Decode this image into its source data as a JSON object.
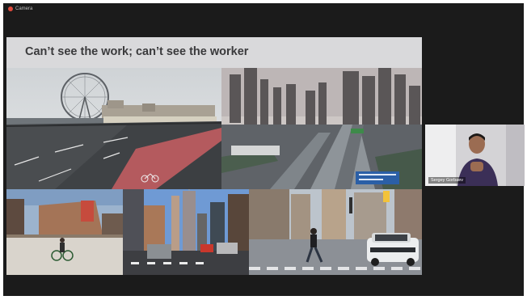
{
  "window": {
    "app_title": "Camera"
  },
  "slide": {
    "title": "Can’t see the work; can’t see the worker"
  },
  "participant": {
    "name": "Sergey Gorbaev"
  },
  "colors": {
    "window_bg": "#1b1b1b",
    "slide_bg": "#d9d9db",
    "title_text": "#3a3a3c",
    "recording_dot": "#e04a3c"
  },
  "icons": [
    "recording-icon"
  ]
}
